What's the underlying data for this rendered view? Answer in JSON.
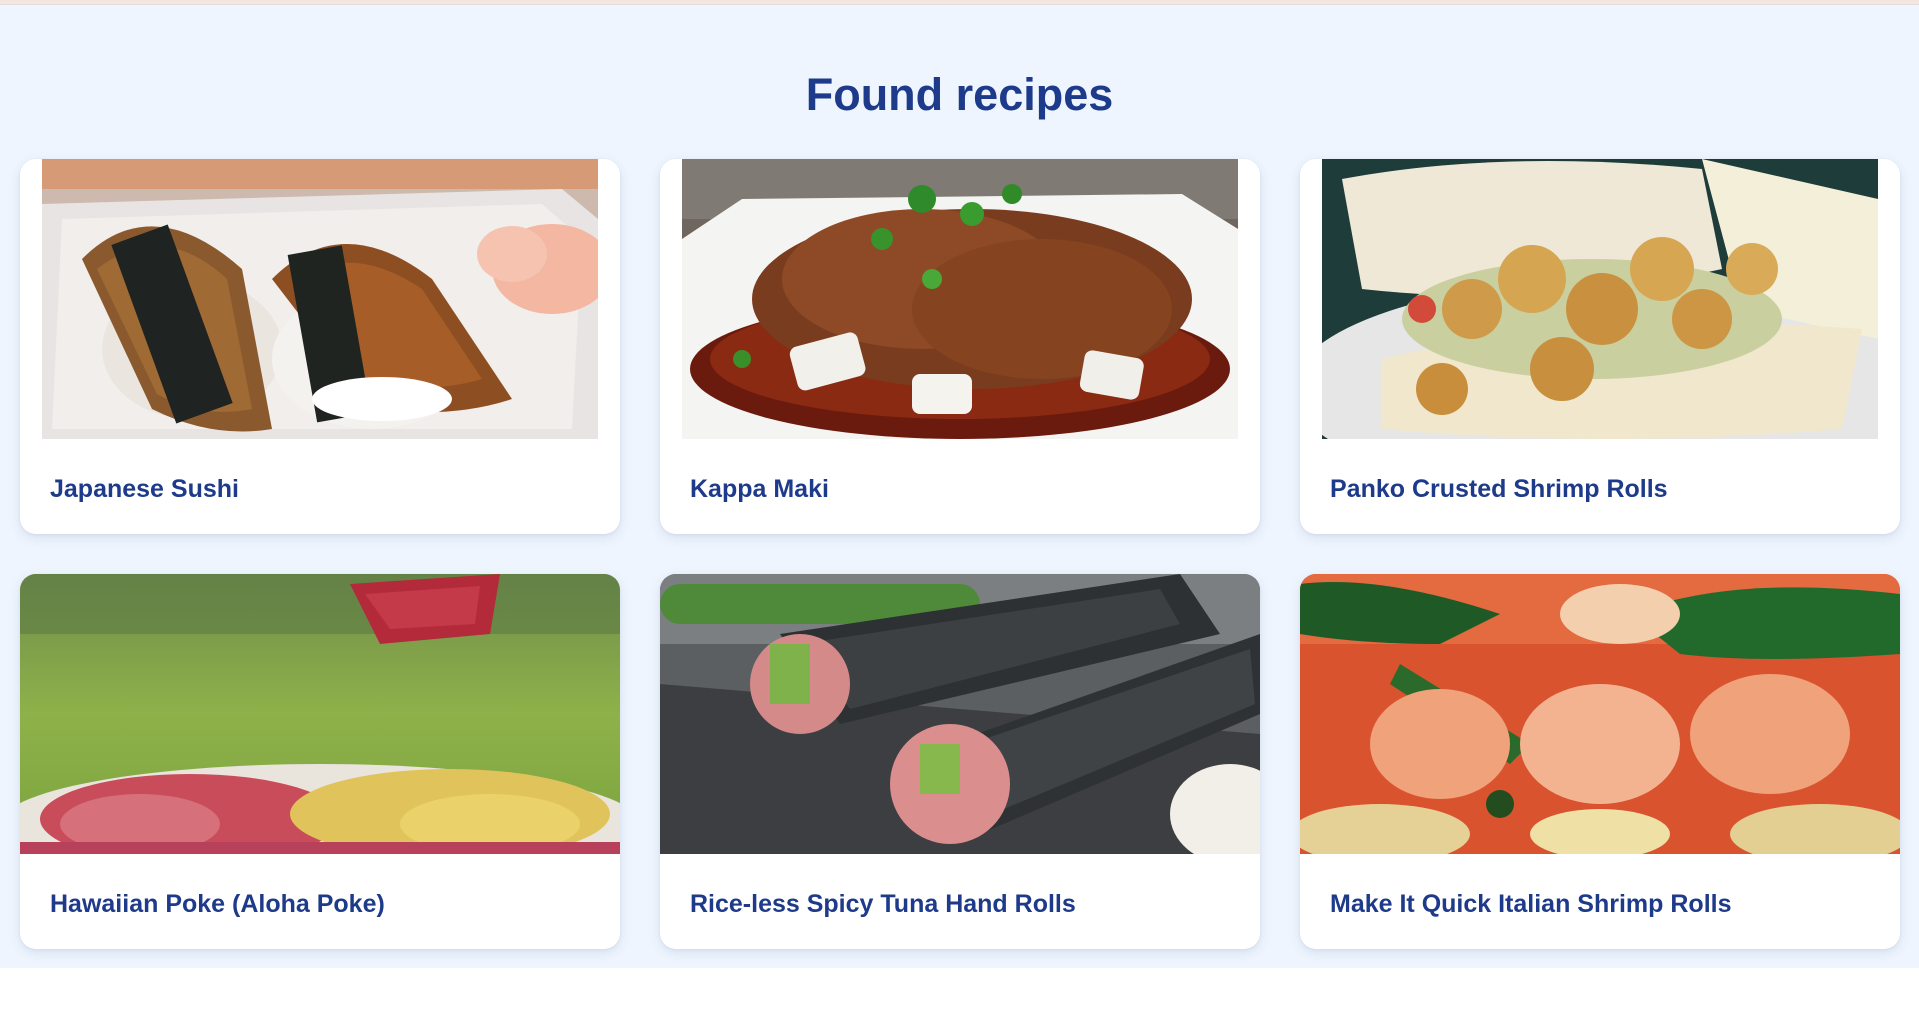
{
  "page": {
    "section_title": "Found recipes"
  },
  "recipes": [
    {
      "title": "Japanese Sushi",
      "image_icon": "sushi-photo"
    },
    {
      "title": "Kappa Maki",
      "image_icon": "spicy-dish-photo"
    },
    {
      "title": "Panko Crusted Shrimp Rolls",
      "image_icon": "shrimp-sandwich-photo"
    },
    {
      "title": "Hawaiian Poke (Aloha Poke)",
      "image_icon": "poke-photo"
    },
    {
      "title": "Rice-less Spicy Tuna Hand Rolls",
      "image_icon": "hand-roll-photo"
    },
    {
      "title": "Make It Quick Italian Shrimp Rolls",
      "image_icon": "italian-shrimp-photo"
    }
  ],
  "colors": {
    "title": "#1e3a8a",
    "section_background": "#eef5fe",
    "card_background": "#ffffff"
  }
}
